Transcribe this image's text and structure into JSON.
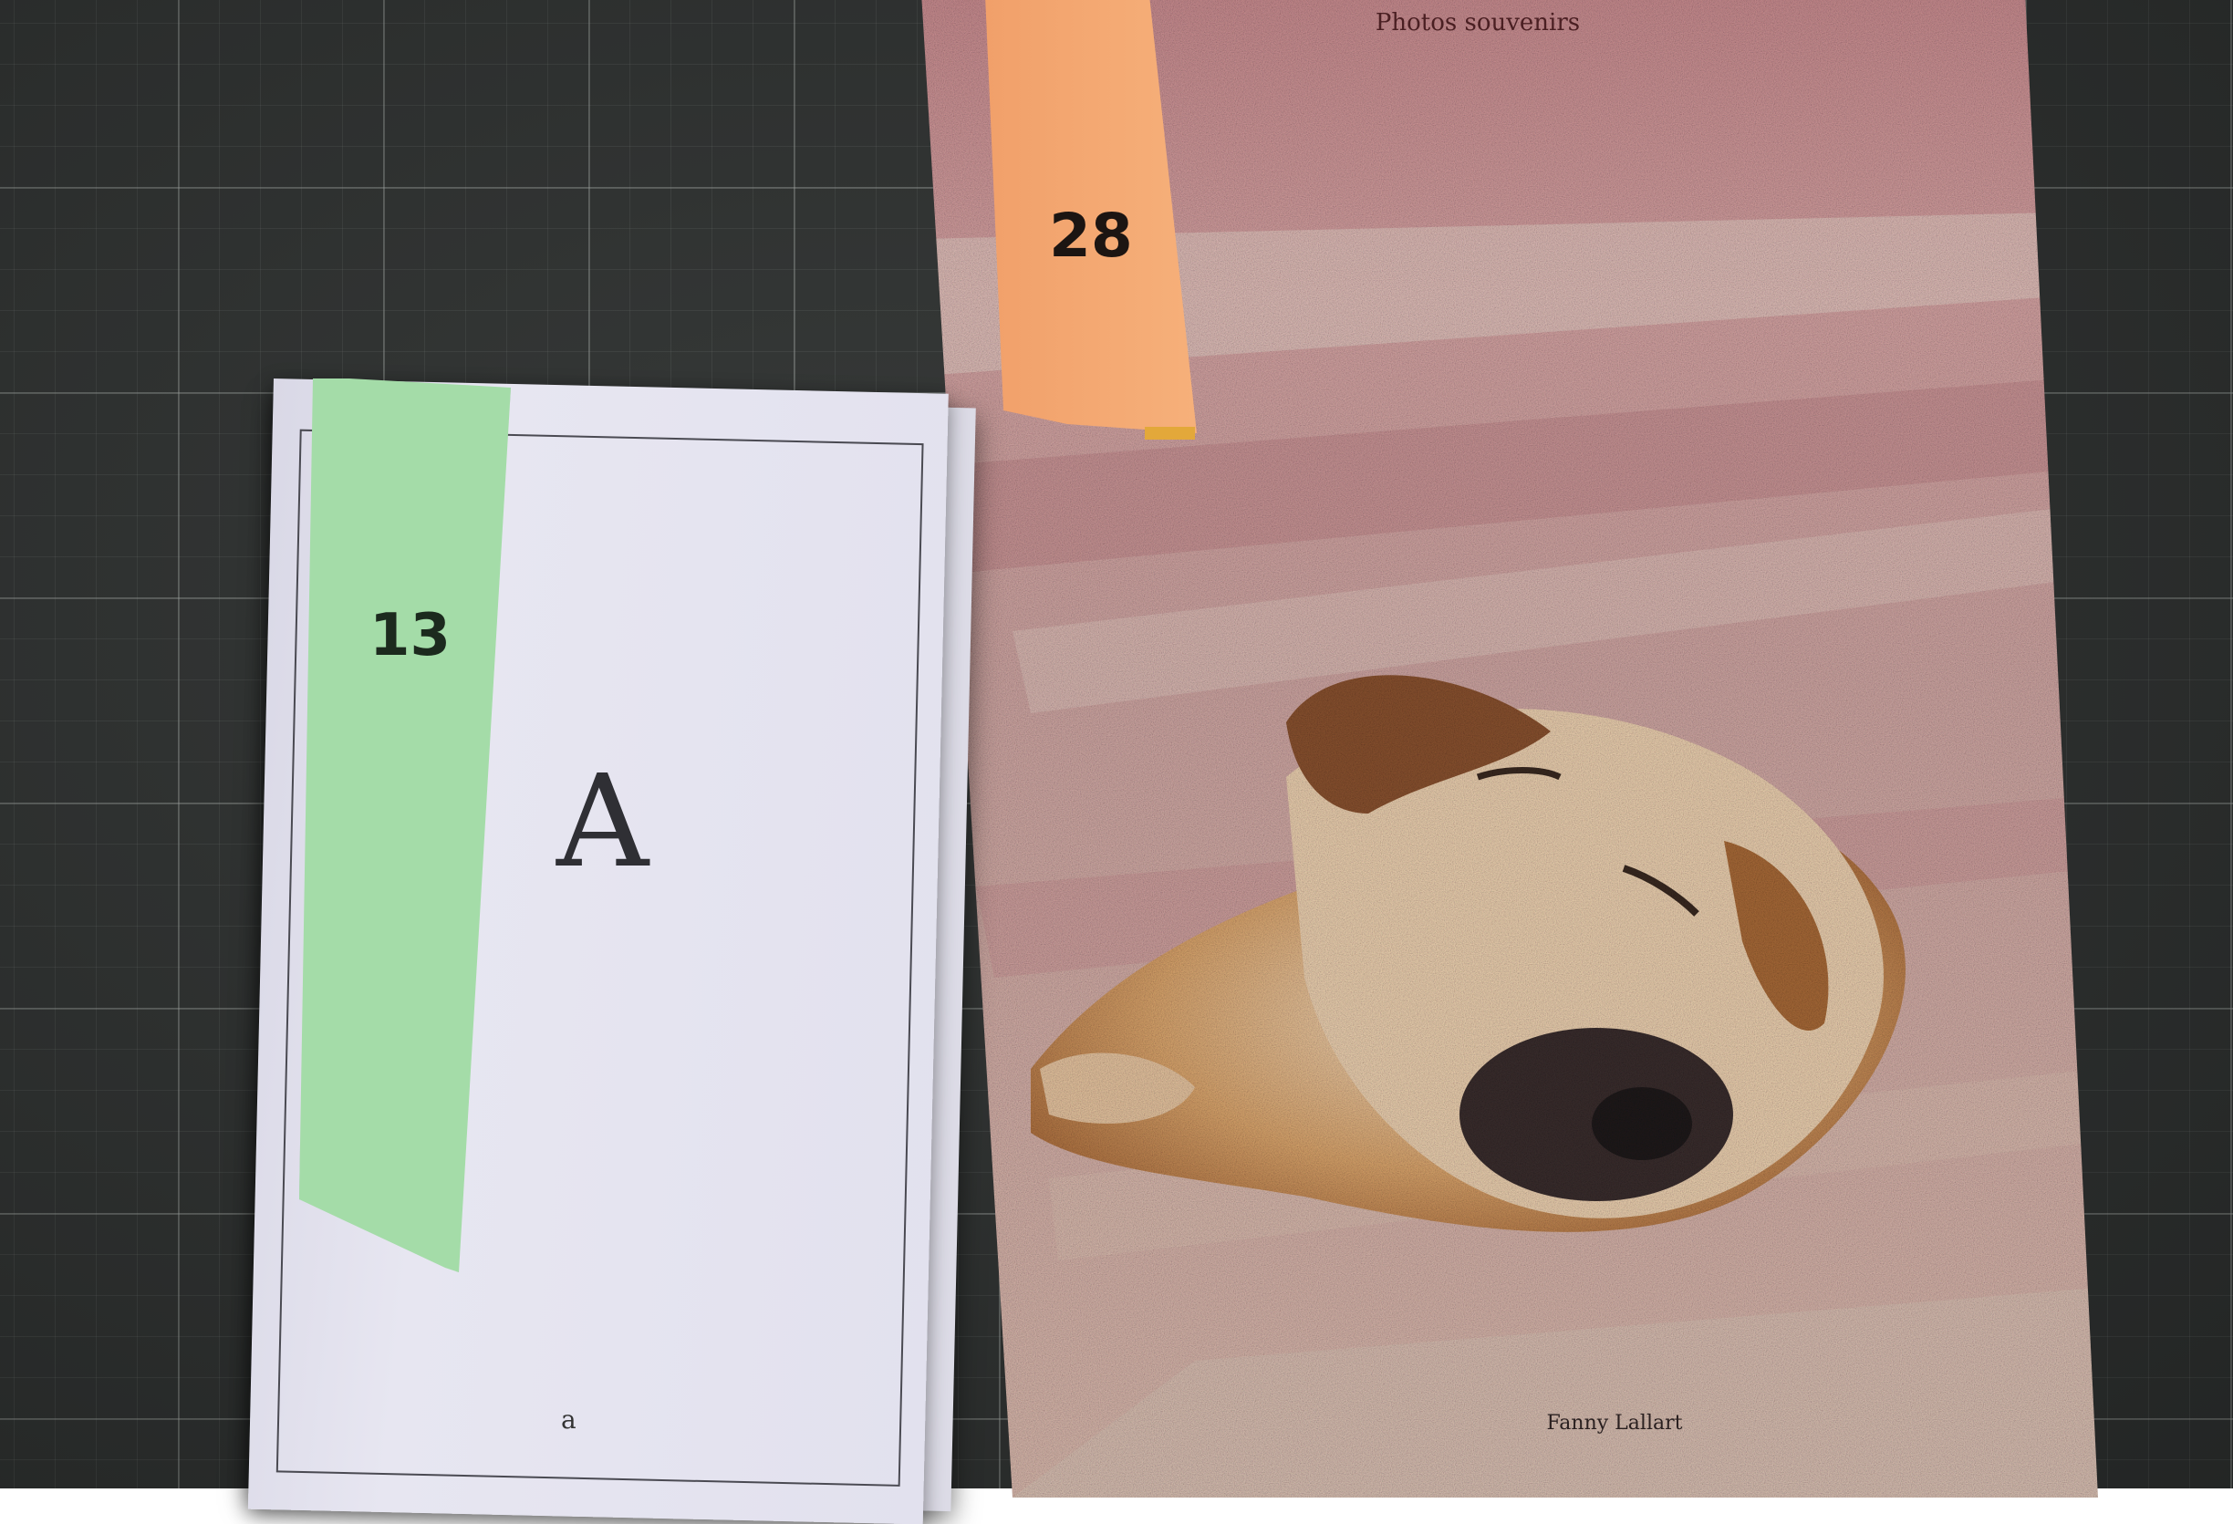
{
  "photo_book": {
    "title": "Photos souvenirs",
    "author": "Fanny Lallart"
  },
  "booklet": {
    "small_letter": "A",
    "large_letter": "A",
    "bottom_letter": "a"
  },
  "tabs": {
    "green_number": "13",
    "orange_number": "28",
    "green_color": "#a4dca8",
    "orange_color": "#f4a872"
  }
}
